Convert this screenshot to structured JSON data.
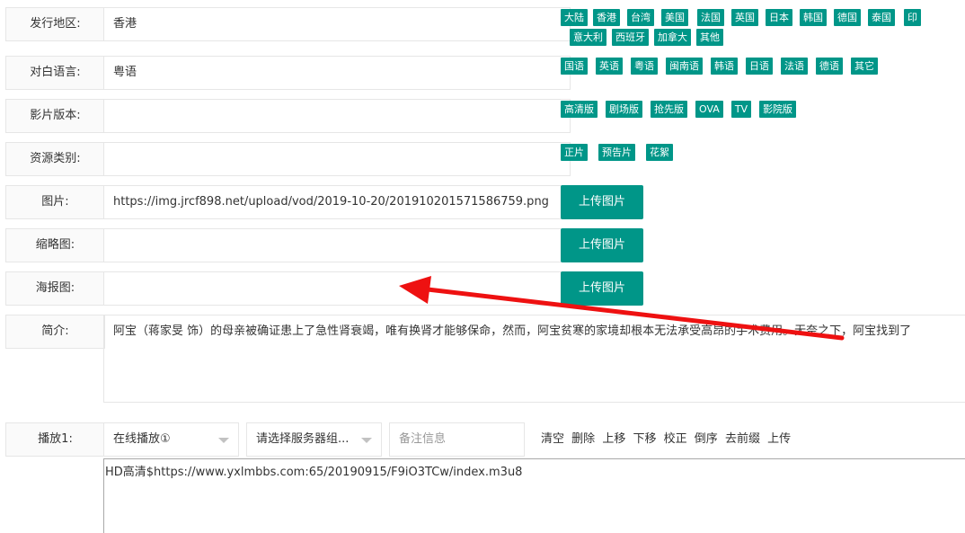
{
  "region": {
    "label": "发行地区:",
    "value": "香港",
    "tags": [
      "大陆",
      "香港",
      "台湾",
      "美国",
      "法国",
      "英国",
      "日本",
      "韩国",
      "德国",
      "泰国",
      "印",
      "意大利",
      "西班牙",
      "加拿大",
      "其他"
    ]
  },
  "language": {
    "label": "对白语言:",
    "value": "粤语",
    "tags": [
      "国语",
      "英语",
      "粤语",
      "闽南语",
      "韩语",
      "日语",
      "法语",
      "德语",
      "其它"
    ]
  },
  "version": {
    "label": "影片版本:",
    "value": "",
    "tags": [
      "高清版",
      "剧场版",
      "抢先版",
      "OVA",
      "TV",
      "影院版"
    ]
  },
  "resource_type": {
    "label": "资源类别:",
    "value": "",
    "tags": [
      "正片",
      "预告片",
      "花絮"
    ]
  },
  "picture": {
    "label": "图片:",
    "value": "https://img.jrcf898.net/upload/vod/2019-10-20/201910201571586759.png",
    "upload_label": "上传图片"
  },
  "thumbnail": {
    "label": "缩略图:",
    "value": "",
    "upload_label": "上传图片"
  },
  "poster": {
    "label": "海报图:",
    "value": "",
    "upload_label": "上传图片"
  },
  "intro": {
    "label": "简介:",
    "value": "阿宝（蒋家旻 饰）的母亲被确证患上了急性肾衰竭，唯有换肾才能够保命，然而，阿宝贫寒的家境却根本无法承受高昂的手术费用。无奈之下，阿宝找到了"
  },
  "play": {
    "label": "播放1:",
    "player_select": "在线播放①",
    "server_select": "请选择服务器组...",
    "note_placeholder": "备注信息",
    "actions": [
      "清空",
      "删除",
      "上移",
      "下移",
      "校正",
      "倒序",
      "去前缀",
      "上传"
    ],
    "url_text": "HD高清$https://www.yxlmbbs.com:65/20190915/F9iO3TCw/index.m3u8"
  },
  "colors": {
    "tag": "#009688",
    "arrow": "#ee1111"
  }
}
